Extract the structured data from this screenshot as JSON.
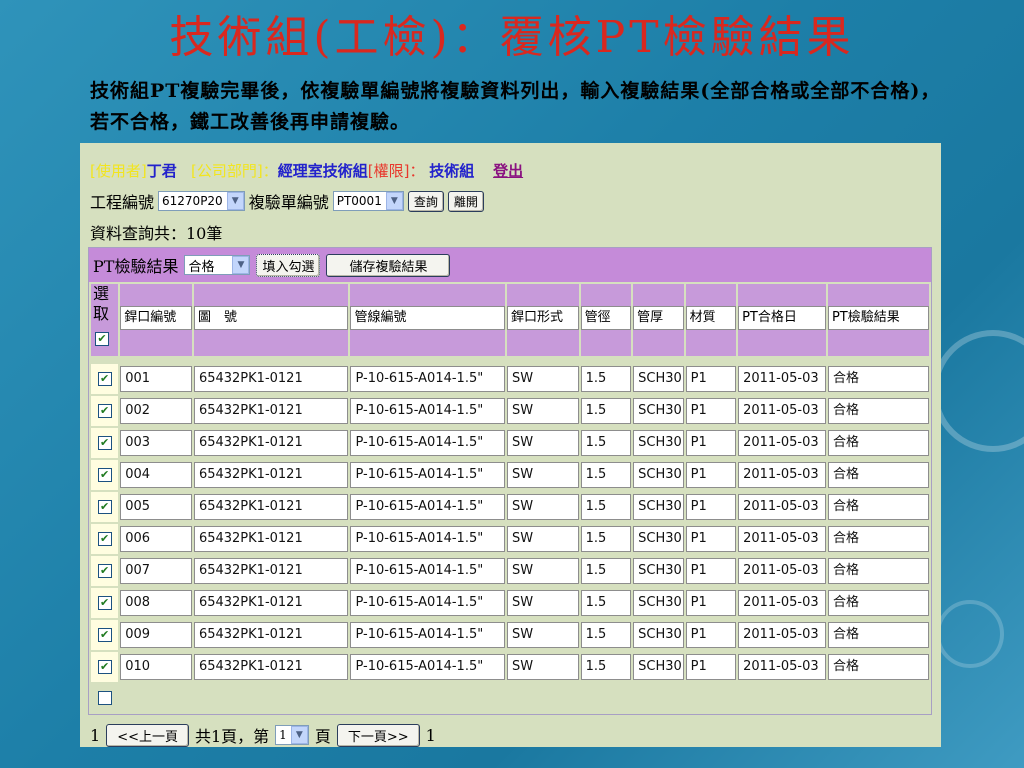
{
  "slide": {
    "title": "技術組(工檢)：覆核PT檢驗結果",
    "description": "技術組PT複驗完畢後，依複驗單編號將複驗資料列出，輸入複驗結果(全部合格或全部不合格)，若不合格，鐵工改善後再申請複驗。"
  },
  "userbar": {
    "user_label": "[使用者]",
    "user_name": "丁君",
    "dept_label": "[公司部門]：",
    "dept_name": "經理室技術組",
    "role_label": "[權限]：",
    "role_name": "技術組",
    "logout": "登出"
  },
  "filters": {
    "project_label": "工程編號",
    "project_value": "61270P20",
    "recheck_label": "複驗單編號",
    "recheck_value": "PT0001",
    "query_button": "查詢",
    "leave_button": "離開",
    "count_text": "資料查詢共：10筆"
  },
  "grid": {
    "result_label": "PT檢驗結果",
    "result_value": "合格",
    "fill_button": "填入勾選",
    "save_button": "儲存複驗結果",
    "headers": {
      "select": "選取",
      "weld_no": "銲口編號",
      "drawing": "圖　號",
      "line_no": "管線編號",
      "weld_type": "銲口形式",
      "diameter": "管徑",
      "thickness": "管厚",
      "material": "材質",
      "pt_date": "PT合格日",
      "pt_result": "PT檢驗結果"
    },
    "rows": [
      {
        "weld_no": "001",
        "drawing": "65432PK1-0121",
        "line_no": "P-10-615-A014-1.5\"",
        "weld_type": "SW",
        "diameter": "1.5",
        "thickness": "SCH30",
        "material": "P1",
        "pt_date": "2011-05-03",
        "pt_result": "合格",
        "checked": true
      },
      {
        "weld_no": "002",
        "drawing": "65432PK1-0121",
        "line_no": "P-10-615-A014-1.5\"",
        "weld_type": "SW",
        "diameter": "1.5",
        "thickness": "SCH30",
        "material": "P1",
        "pt_date": "2011-05-03",
        "pt_result": "合格",
        "checked": true
      },
      {
        "weld_no": "003",
        "drawing": "65432PK1-0121",
        "line_no": "P-10-615-A014-1.5\"",
        "weld_type": "SW",
        "diameter": "1.5",
        "thickness": "SCH30",
        "material": "P1",
        "pt_date": "2011-05-03",
        "pt_result": "合格",
        "checked": true
      },
      {
        "weld_no": "004",
        "drawing": "65432PK1-0121",
        "line_no": "P-10-615-A014-1.5\"",
        "weld_type": "SW",
        "diameter": "1.5",
        "thickness": "SCH30",
        "material": "P1",
        "pt_date": "2011-05-03",
        "pt_result": "合格",
        "checked": true
      },
      {
        "weld_no": "005",
        "drawing": "65432PK1-0121",
        "line_no": "P-10-615-A014-1.5\"",
        "weld_type": "SW",
        "diameter": "1.5",
        "thickness": "SCH30",
        "material": "P1",
        "pt_date": "2011-05-03",
        "pt_result": "合格",
        "checked": true
      },
      {
        "weld_no": "006",
        "drawing": "65432PK1-0121",
        "line_no": "P-10-615-A014-1.5\"",
        "weld_type": "SW",
        "diameter": "1.5",
        "thickness": "SCH30",
        "material": "P1",
        "pt_date": "2011-05-03",
        "pt_result": "合格",
        "checked": true
      },
      {
        "weld_no": "007",
        "drawing": "65432PK1-0121",
        "line_no": "P-10-615-A014-1.5\"",
        "weld_type": "SW",
        "diameter": "1.5",
        "thickness": "SCH30",
        "material": "P1",
        "pt_date": "2011-05-03",
        "pt_result": "合格",
        "checked": true
      },
      {
        "weld_no": "008",
        "drawing": "65432PK1-0121",
        "line_no": "P-10-615-A014-1.5\"",
        "weld_type": "SW",
        "diameter": "1.5",
        "thickness": "SCH30",
        "material": "P1",
        "pt_date": "2011-05-03",
        "pt_result": "合格",
        "checked": true
      },
      {
        "weld_no": "009",
        "drawing": "65432PK1-0121",
        "line_no": "P-10-615-A014-1.5\"",
        "weld_type": "SW",
        "diameter": "1.5",
        "thickness": "SCH30",
        "material": "P1",
        "pt_date": "2011-05-03",
        "pt_result": "合格",
        "checked": true
      },
      {
        "weld_no": "010",
        "drawing": "65432PK1-0121",
        "line_no": "P-10-615-A014-1.5\"",
        "weld_type": "SW",
        "diameter": "1.5",
        "thickness": "SCH30",
        "material": "P1",
        "pt_date": "2011-05-03",
        "pt_result": "合格",
        "checked": true
      }
    ]
  },
  "pager": {
    "current_start": "1",
    "prev_button": "<<上一頁",
    "total_pages_text": "共1頁，第",
    "page_select_value": "1",
    "page_suffix": "頁",
    "next_button": "下一頁>>",
    "current_end": "1"
  },
  "icons": {
    "dropdown": "chevron-down-icon",
    "checkbox_checked": "check-icon"
  },
  "colors": {
    "title": "#d9281f",
    "panel_bg": "#d6e0bf",
    "grid_header": "#c58bd9",
    "user_label": "#f2e51f",
    "user_value": "#2222cc"
  }
}
